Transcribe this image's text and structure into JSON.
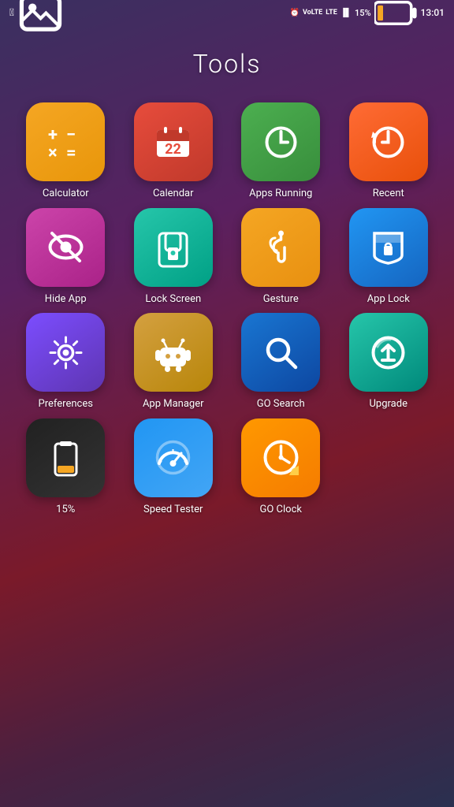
{
  "statusBar": {
    "leftIcons": [
      "fb-icon",
      "image-icon"
    ],
    "alarm": "alarm",
    "voLte": "VoLTE",
    "lte": "LTE 1",
    "signal": "signal",
    "battery": "15%",
    "time": "13:01"
  },
  "pageTitle": "Tools",
  "apps": [
    {
      "id": "calculator",
      "label": "Calculator",
      "bg": "bg-calculator"
    },
    {
      "id": "calendar",
      "label": "Calendar",
      "bg": "bg-calendar"
    },
    {
      "id": "apps-running",
      "label": "Apps Running",
      "bg": "bg-apps-running"
    },
    {
      "id": "recent",
      "label": "Recent",
      "bg": "bg-recent"
    },
    {
      "id": "hide-app",
      "label": "Hide App",
      "bg": "bg-hide-app"
    },
    {
      "id": "lock-screen",
      "label": "Lock Screen",
      "bg": "bg-lock-screen"
    },
    {
      "id": "gesture",
      "label": "Gesture",
      "bg": "bg-gesture"
    },
    {
      "id": "app-lock",
      "label": "App Lock",
      "bg": "bg-app-lock"
    },
    {
      "id": "preferences",
      "label": "Preferences",
      "bg": "bg-preferences"
    },
    {
      "id": "app-manager",
      "label": "App Manager",
      "bg": "bg-app-manager"
    },
    {
      "id": "go-search",
      "label": "GO Search",
      "bg": "bg-go-search"
    },
    {
      "id": "upgrade",
      "label": "Upgrade",
      "bg": "bg-upgrade"
    },
    {
      "id": "battery",
      "label": "15%",
      "bg": "bg-battery"
    },
    {
      "id": "speed-tester",
      "label": "Speed Tester",
      "bg": "bg-speed-tester"
    },
    {
      "id": "go-clock",
      "label": "GO Clock",
      "bg": "bg-go-clock"
    }
  ]
}
